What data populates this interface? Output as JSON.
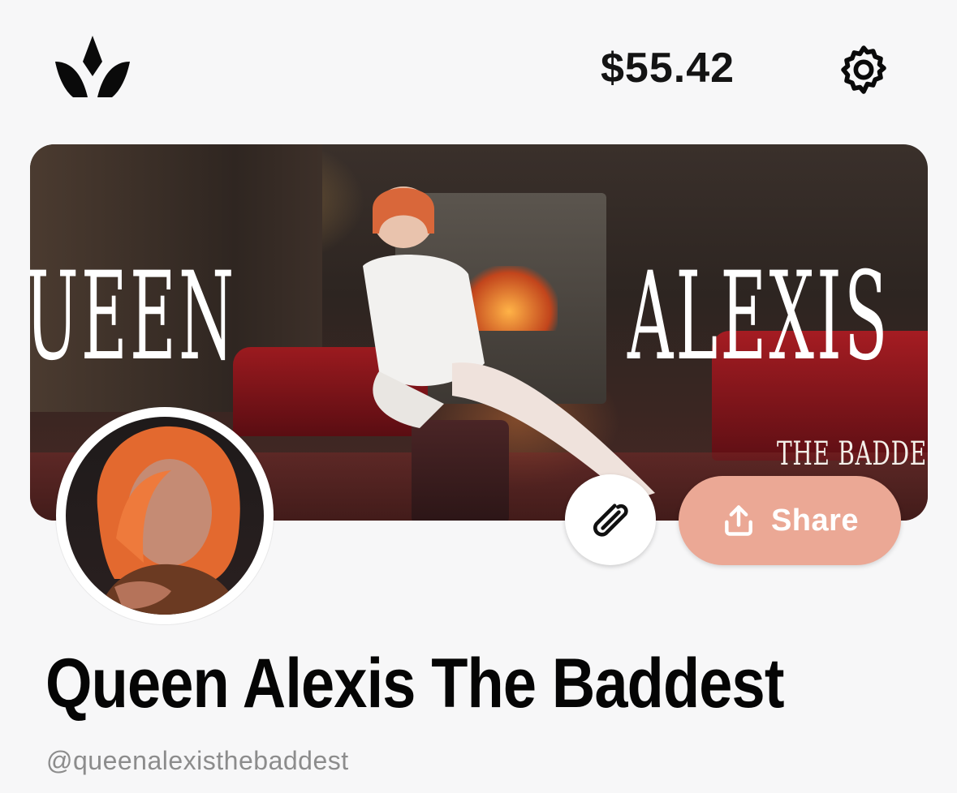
{
  "header": {
    "logo_icon": "crown-flame-logo",
    "balance": "$55.42",
    "settings_icon": "gear-icon"
  },
  "banner": {
    "word_left": "UEEN",
    "word_right": "ALEXIS",
    "word_sub": "THE BADDE"
  },
  "actions": {
    "edit_icon": "paperclip-icon",
    "share_label": "Share",
    "share_icon": "share-upload-icon",
    "share_color": "#eba895"
  },
  "profile": {
    "display_name": "Queen Alexis The Baddest",
    "handle": "@queenalexisthebaddest"
  }
}
